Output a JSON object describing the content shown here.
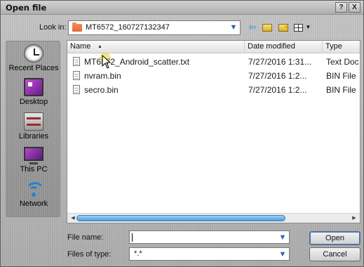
{
  "window": {
    "title": "Open file",
    "help_label": "?",
    "close_label": "X"
  },
  "lookin": {
    "label": "Look in:",
    "value": "MT6572_160727132347"
  },
  "places": [
    {
      "label": "Recent Places",
      "icon": "clock-icon"
    },
    {
      "label": "Desktop",
      "icon": "desktop-icon"
    },
    {
      "label": "Libraries",
      "icon": "libraries-icon"
    },
    {
      "label": "This PC",
      "icon": "computer-icon"
    },
    {
      "label": "Network",
      "icon": "network-icon"
    }
  ],
  "columns": {
    "name": "Name",
    "date": "Date modified",
    "type": "Type"
  },
  "files": [
    {
      "name": "MT6572_Android_scatter.txt",
      "date": "7/27/2016 1:31...",
      "type": "Text Doc"
    },
    {
      "name": "nvram.bin",
      "date": "7/27/2016 1:2...",
      "type": "BIN File"
    },
    {
      "name": "secro.bin",
      "date": "7/27/2016 1:2...",
      "type": "BIN File"
    }
  ],
  "filename": {
    "label": "File name:",
    "value": ""
  },
  "filetype": {
    "label": "Files of type:",
    "value": "*.*"
  },
  "buttons": {
    "open": "Open",
    "cancel": "Cancel"
  },
  "colors": {
    "accent": "#2b62b9",
    "scroll_thumb": "#4d9ee0",
    "folder_orange": "#e06a30"
  }
}
